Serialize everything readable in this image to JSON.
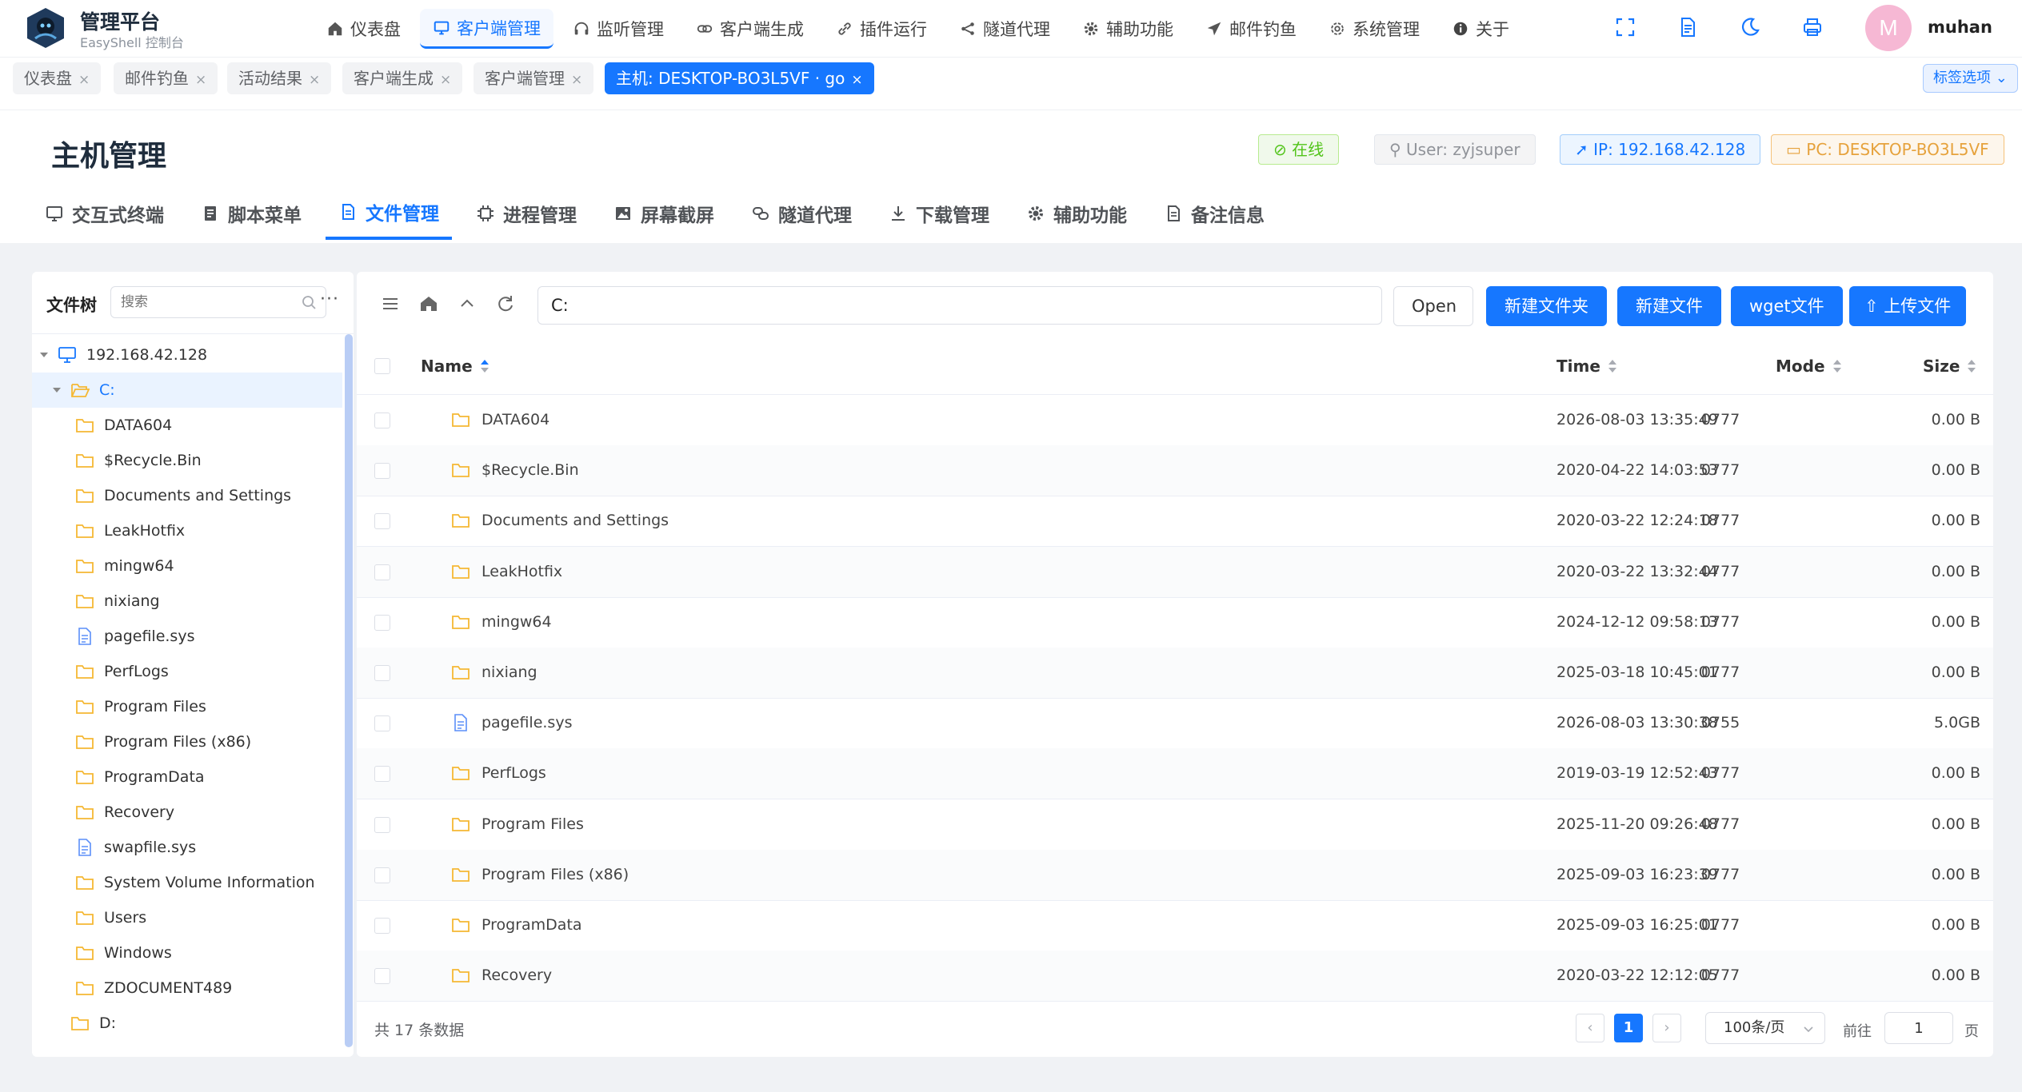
{
  "app": {
    "title": "管理平台",
    "subtitle": "EasyShell 控制台"
  },
  "nav": [
    {
      "label": "仪表盘",
      "icon": "home-icon"
    },
    {
      "label": "客户端管理",
      "icon": "monitor-icon",
      "active": true
    },
    {
      "label": "监听管理",
      "icon": "headset-icon"
    },
    {
      "label": "客户端生成",
      "icon": "link-icon"
    },
    {
      "label": "插件运行",
      "icon": "plugin-link-icon"
    },
    {
      "label": "隧道代理",
      "icon": "share-icon"
    },
    {
      "label": "辅助功能",
      "icon": "gear-icon"
    },
    {
      "label": "邮件钓鱼",
      "icon": "send-icon"
    },
    {
      "label": "系统管理",
      "icon": "settings-icon"
    },
    {
      "label": "关于",
      "icon": "info-icon"
    }
  ],
  "user": {
    "avatar_letter": "M",
    "name": "muhan"
  },
  "page_tabs": [
    {
      "label": "仪表盘"
    },
    {
      "label": "邮件钓鱼"
    },
    {
      "label": "活动结果"
    },
    {
      "label": "客户端生成"
    },
    {
      "label": "客户端管理"
    },
    {
      "label": "主机: DESKTOP-BO3L5VF · go",
      "active": true
    }
  ],
  "tab_options_label": "标签选项",
  "host": {
    "title": "主机管理",
    "status": "在线",
    "user": "User: zyjsuper",
    "ip": "IP: 192.168.42.128",
    "pc": "PC: DESKTOP-BO3L5VF"
  },
  "sub_tabs": [
    {
      "label": "交互式终端",
      "icon": "terminal-icon"
    },
    {
      "label": "脚本菜单",
      "icon": "script-icon"
    },
    {
      "label": "文件管理",
      "icon": "file-icon",
      "active": true
    },
    {
      "label": "进程管理",
      "icon": "cpu-icon"
    },
    {
      "label": "屏幕截屏",
      "icon": "image-icon"
    },
    {
      "label": "隧道代理",
      "icon": "tunnel-icon"
    },
    {
      "label": "下载管理",
      "icon": "download-icon"
    },
    {
      "label": "辅助功能",
      "icon": "gear-icon"
    },
    {
      "label": "备注信息",
      "icon": "note-icon"
    }
  ],
  "tree": {
    "title": "文件树",
    "search_placeholder": "搜索",
    "more": "···",
    "nodes": [
      {
        "label": "192.168.42.128",
        "type": "host",
        "level": 0,
        "expanded": true
      },
      {
        "label": "C:",
        "type": "folder-open",
        "level": 1,
        "expanded": true,
        "selected": true
      },
      {
        "label": "DATA604",
        "type": "folder",
        "level": 2
      },
      {
        "label": "$Recycle.Bin",
        "type": "folder",
        "level": 2
      },
      {
        "label": "Documents and Settings",
        "type": "folder",
        "level": 2
      },
      {
        "label": "LeakHotfix",
        "type": "folder",
        "level": 2
      },
      {
        "label": "mingw64",
        "type": "folder",
        "level": 2
      },
      {
        "label": "nixiang",
        "type": "folder",
        "level": 2
      },
      {
        "label": "pagefile.sys",
        "type": "file",
        "level": 2
      },
      {
        "label": "PerfLogs",
        "type": "folder",
        "level": 2
      },
      {
        "label": "Program Files",
        "type": "folder",
        "level": 2
      },
      {
        "label": "Program Files (x86)",
        "type": "folder",
        "level": 2
      },
      {
        "label": "ProgramData",
        "type": "folder",
        "level": 2
      },
      {
        "label": "Recovery",
        "type": "folder",
        "level": 2
      },
      {
        "label": "swapfile.sys",
        "type": "file",
        "level": 2
      },
      {
        "label": "System Volume Information",
        "type": "folder",
        "level": 2
      },
      {
        "label": "Users",
        "type": "folder",
        "level": 2
      },
      {
        "label": "Windows",
        "type": "folder",
        "level": 2
      },
      {
        "label": "ZDOCUMENT489",
        "type": "folder",
        "level": 2
      },
      {
        "label": "D:",
        "type": "folder",
        "level": 1
      }
    ]
  },
  "toolbar": {
    "path": "C:",
    "open_label": "Open",
    "buttons": [
      "新建文件夹",
      "新建文件",
      "wget文件",
      "上传文件"
    ]
  },
  "table": {
    "columns": {
      "name": "Name",
      "time": "Time",
      "mode": "Mode",
      "size": "Size"
    },
    "rows": [
      {
        "name": "DATA604",
        "type": "folder",
        "time": "2026-08-03 13:35:49",
        "mode": "0777",
        "size": "0.00 B"
      },
      {
        "name": "$Recycle.Bin",
        "type": "folder",
        "time": "2020-04-22 14:03:53",
        "mode": "0777",
        "size": "0.00 B"
      },
      {
        "name": "Documents and Settings",
        "type": "folder",
        "time": "2020-03-22 12:24:18",
        "mode": "0777",
        "size": "0.00 B"
      },
      {
        "name": "LeakHotfix",
        "type": "folder",
        "time": "2020-03-22 13:32:44",
        "mode": "0777",
        "size": "0.00 B"
      },
      {
        "name": "mingw64",
        "type": "folder",
        "time": "2024-12-12 09:58:13",
        "mode": "0777",
        "size": "0.00 B"
      },
      {
        "name": "nixiang",
        "type": "folder",
        "time": "2025-03-18 10:45:01",
        "mode": "0777",
        "size": "0.00 B"
      },
      {
        "name": "pagefile.sys",
        "type": "file",
        "time": "2026-08-03 13:30:38",
        "mode": "0755",
        "size": "5.0GB"
      },
      {
        "name": "PerfLogs",
        "type": "folder",
        "time": "2019-03-19 12:52:43",
        "mode": "0777",
        "size": "0.00 B"
      },
      {
        "name": "Program Files",
        "type": "folder",
        "time": "2025-11-20 09:26:48",
        "mode": "0777",
        "size": "0.00 B"
      },
      {
        "name": "Program Files (x86)",
        "type": "folder",
        "time": "2025-09-03 16:23:39",
        "mode": "0777",
        "size": "0.00 B"
      },
      {
        "name": "ProgramData",
        "type": "folder",
        "time": "2025-09-03 16:25:01",
        "mode": "0777",
        "size": "0.00 B"
      },
      {
        "name": "Recovery",
        "type": "folder",
        "time": "2020-03-22 12:12:05",
        "mode": "0777",
        "size": "0.00 B"
      }
    ]
  },
  "pagination": {
    "total_text": "共 17 条数据",
    "current_page": "1",
    "page_size": "100条/页",
    "goto_label": "前往",
    "goto_value": "1",
    "page_suffix": "页"
  },
  "colors": {
    "primary": "#1677ff",
    "folder": "#f5b833",
    "success": "#52c41a",
    "warning": "#e6a23c"
  }
}
